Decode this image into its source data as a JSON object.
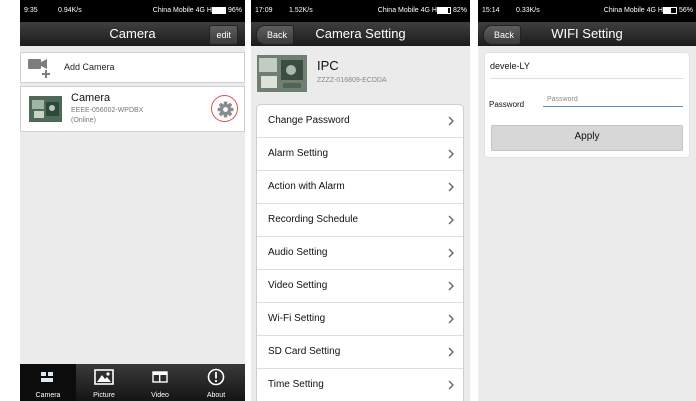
{
  "panel1": {
    "status": {
      "time": "9:35",
      "speed": "0.94K/s",
      "carrier": "China Mobile 4G HD",
      "battery": "96%",
      "battery_level": 0.96
    },
    "title": "Camera",
    "edit_label": "edit",
    "add_camera_label": "Add Camera",
    "camera": {
      "name": "Camera",
      "uid": "EEEE-056002-WPDBX",
      "status": "(Online)"
    },
    "tabs": [
      {
        "label": "Camera",
        "icon": "camera-tab-icon",
        "active": true
      },
      {
        "label": "Picture",
        "icon": "picture-icon",
        "active": false
      },
      {
        "label": "Video",
        "icon": "video-icon",
        "active": false
      },
      {
        "label": "About",
        "icon": "info-icon",
        "active": false
      }
    ]
  },
  "panel2": {
    "status": {
      "time": "17:09",
      "speed": "1.52K/s",
      "carrier": "China Mobile 4G HD",
      "battery": "82%",
      "battery_level": 0.82
    },
    "back_label": "Back",
    "title": "Camera Setting",
    "device": {
      "name": "IPC",
      "uid": "ZZZZ-016809-ECDDA"
    },
    "menu": [
      "Change Password",
      "Alarm Setting",
      "Action with Alarm",
      "Recording Schedule",
      "Audio Setting",
      "Video Setting",
      "Wi-Fi Setting",
      "SD Card Setting",
      "Time Setting"
    ]
  },
  "panel3": {
    "status": {
      "time": "15:14",
      "speed": "0.33K/s",
      "carrier": "China Mobile 4G HD",
      "battery": "56%",
      "battery_level": 0.56
    },
    "back_label": "Back",
    "title": "WIFI Setting",
    "ssid": "devele-LY",
    "password_label": "Password",
    "password_placeholder": "Password",
    "apply_label": "Apply"
  },
  "colors": {
    "highlight_ring": "#e74c4c",
    "input_underline": "#5a8fbf",
    "titlebar": "#2a2a2a"
  }
}
